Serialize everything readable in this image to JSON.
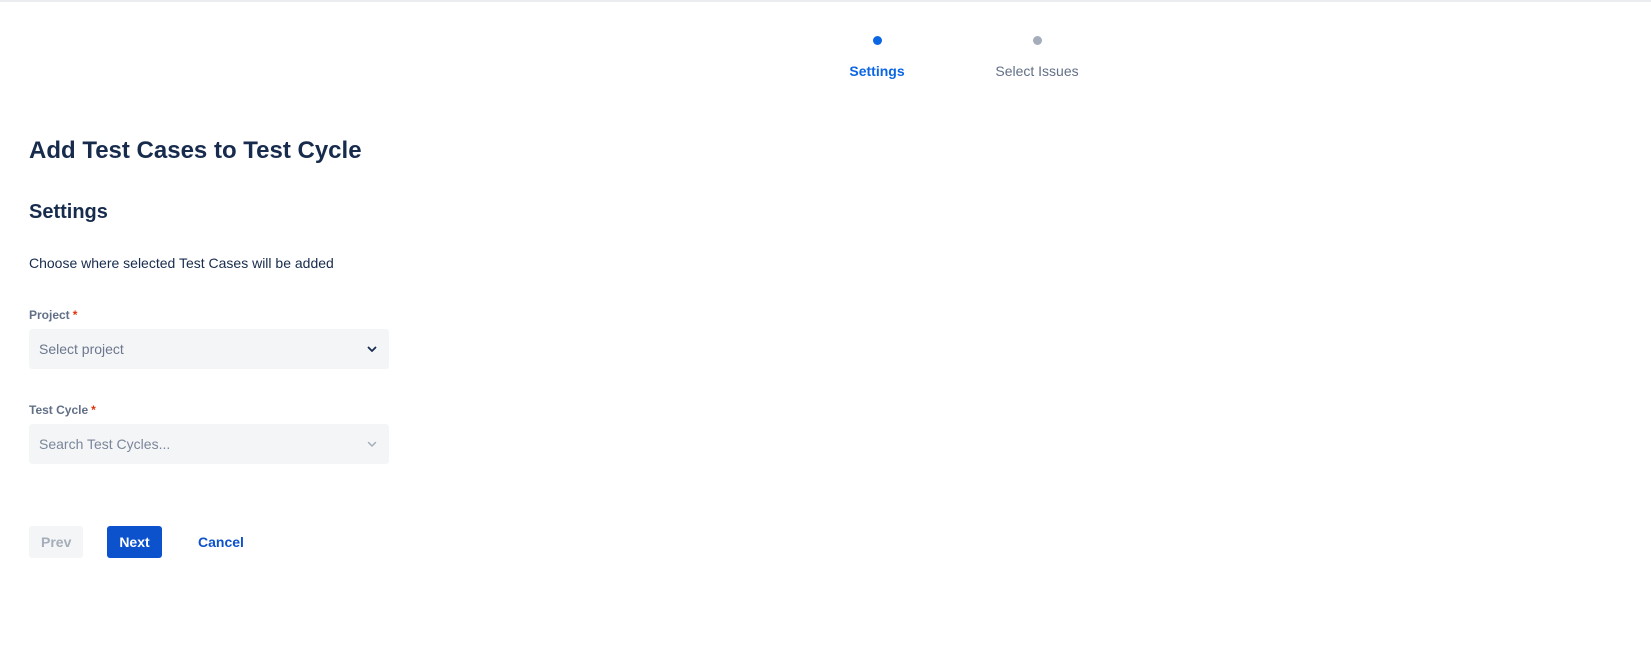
{
  "stepper": {
    "steps": [
      {
        "label": "Settings",
        "state": "active"
      },
      {
        "label": "Select Issues",
        "state": "inactive"
      }
    ]
  },
  "main": {
    "title": "Add Test Cases to Test Cycle",
    "section_title": "Settings",
    "description": "Choose where selected Test Cases will be added"
  },
  "form": {
    "project": {
      "label": "Project",
      "required_mark": "*",
      "placeholder": "Select project",
      "icon": "chevron-down-icon"
    },
    "test_cycle": {
      "label": "Test Cycle",
      "required_mark": "*",
      "placeholder": "Search Test Cycles...",
      "icon": "chevron-down-icon",
      "disabled": true
    }
  },
  "actions": {
    "prev_label": "Prev",
    "next_label": "Next",
    "cancel_label": "Cancel"
  },
  "colors": {
    "accent": "#0c66e4",
    "primary_button": "#0c52cc",
    "required": "#de350b",
    "text": "#172b4d",
    "muted": "#626f86",
    "field_bg": "#f4f5f7"
  }
}
